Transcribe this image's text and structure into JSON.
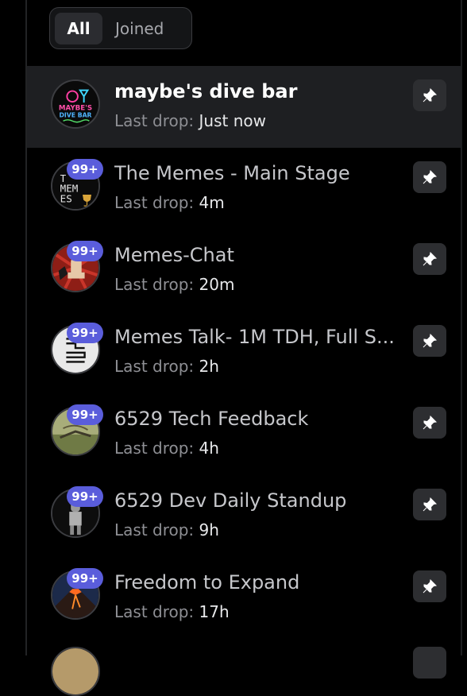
{
  "toggle": {
    "all_label": "All",
    "joined_label": "Joined"
  },
  "waves": [
    {
      "title": "maybe's dive bar",
      "last_drop_label": "Last drop:",
      "last_drop": "Just now",
      "badge": "",
      "avatar": "neon-sign"
    },
    {
      "title": "The Memes - Main Stage",
      "last_drop_label": "Last drop:",
      "last_drop": "4m",
      "badge": "99+",
      "avatar": "memes-text"
    },
    {
      "title": "Memes-Chat",
      "last_drop_label": "Last drop:",
      "last_drop": "20m",
      "badge": "99+",
      "avatar": "fist-rays"
    },
    {
      "title": "Memes Talk- 1M TDH, Full S...",
      "last_drop_label": "Last drop:",
      "last_drop": "2h",
      "badge": "99+",
      "avatar": "glyph"
    },
    {
      "title": "6529 Tech Feedback",
      "last_drop_label": "Last drop:",
      "last_drop": "4h",
      "badge": "99+",
      "avatar": "landscape"
    },
    {
      "title": "6529 Dev Daily Standup",
      "last_drop_label": "Last drop:",
      "last_drop": "9h",
      "badge": "99+",
      "avatar": "statue"
    },
    {
      "title": "Freedom to Expand",
      "last_drop_label": "Last drop:",
      "last_drop": "17h",
      "badge": "99+",
      "avatar": "volcano"
    }
  ],
  "colors": {
    "badge": "#5a5ddb",
    "selected_row": "#1e1f22",
    "pin_button": "#2d2e31"
  }
}
